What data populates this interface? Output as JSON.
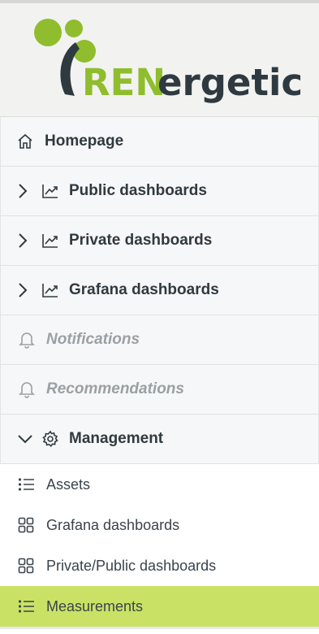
{
  "logo": {
    "text_green": "REN",
    "text_dark": "ergetic",
    "brand_green": "#8fbd2d",
    "brand_dark": "#2f3a40"
  },
  "menu": {
    "items": [
      {
        "label": "Homepage",
        "icon": "home-icon"
      },
      {
        "label": "Public dashboards",
        "icon": "chart-line-icon",
        "expand": "chevron-right-icon"
      },
      {
        "label": "Private dashboards",
        "icon": "chart-line-icon",
        "expand": "chevron-right-icon"
      },
      {
        "label": "Grafana dashboards",
        "icon": "chart-line-icon",
        "expand": "chevron-right-icon"
      },
      {
        "label": "Notifications",
        "icon": "bell-icon",
        "disabled": true
      },
      {
        "label": "Recommendations",
        "icon": "bell-icon",
        "disabled": true
      },
      {
        "label": "Management",
        "icon": "gear-icon",
        "expand": "chevron-down-icon"
      }
    ],
    "management_children": [
      {
        "label": "Assets",
        "icon": "list-icon"
      },
      {
        "label": "Grafana dashboards",
        "icon": "grid-icon"
      },
      {
        "label": "Private/Public dashboards",
        "icon": "grid-icon"
      },
      {
        "label": "Measurements",
        "icon": "list-icon",
        "active": true
      }
    ]
  },
  "colors": {
    "active_bg": "#c9e265",
    "disabled_text": "#9aa0a4"
  }
}
